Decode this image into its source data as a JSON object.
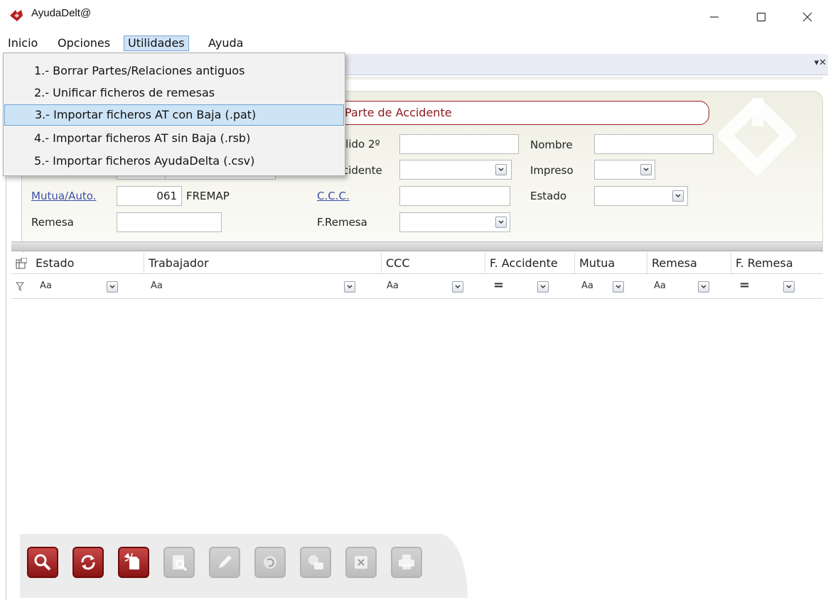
{
  "window": {
    "title": "AyudaDelt@",
    "icon": "app-logo-icon",
    "controls": [
      "minimize-icon",
      "maximize-icon",
      "close-icon"
    ]
  },
  "menubar": {
    "items": [
      "Inicio",
      "Opciones",
      "Utilidades",
      "Ayuda"
    ],
    "active": "Utilidades"
  },
  "dropdown": {
    "items": [
      "1.- Borrar Partes/Relaciones antiguos",
      "2.- Unificar ficheros de remesas",
      "3.- Importar ficheros AT con Baja (.pat)",
      "4.- Importar ficheros AT sin Baja (.rsb)",
      "5.- Importar ficheros AyudaDelta (.csv)"
    ],
    "highlighted_index": 2
  },
  "form": {
    "title": "Parte de Accidente",
    "labels": {
      "apellido2": "llido 2º",
      "nombre": "Nombre",
      "accidente": "cidente",
      "impreso": "Impreso",
      "mutua": "Mutua/Auto.",
      "ccc": "C.C.C.",
      "estado": "Estado",
      "remesa": "Remesa",
      "fremesa": "F.Remesa"
    },
    "values": {
      "mutua_code": "061",
      "mutua_name": "FREMAP"
    }
  },
  "grid": {
    "columns": [
      "Estado",
      "Trabajador",
      "CCC",
      "F. Accidente",
      "Mutua",
      "Remesa",
      "F. Remesa"
    ],
    "filter_text": "Aa",
    "filter_equals": "="
  },
  "toolbar": {
    "buttons": [
      "search-icon",
      "refresh-icon",
      "new-icon",
      "preview-icon",
      "edit-icon",
      "undo-icon",
      "email-icon",
      "excel-icon",
      "print-icon"
    ],
    "enabled_count": 3
  },
  "colors": {
    "accent_red": "#8b1a1a",
    "menu_highlight": "#cde4f6",
    "link_blue": "#3a4ea8"
  }
}
